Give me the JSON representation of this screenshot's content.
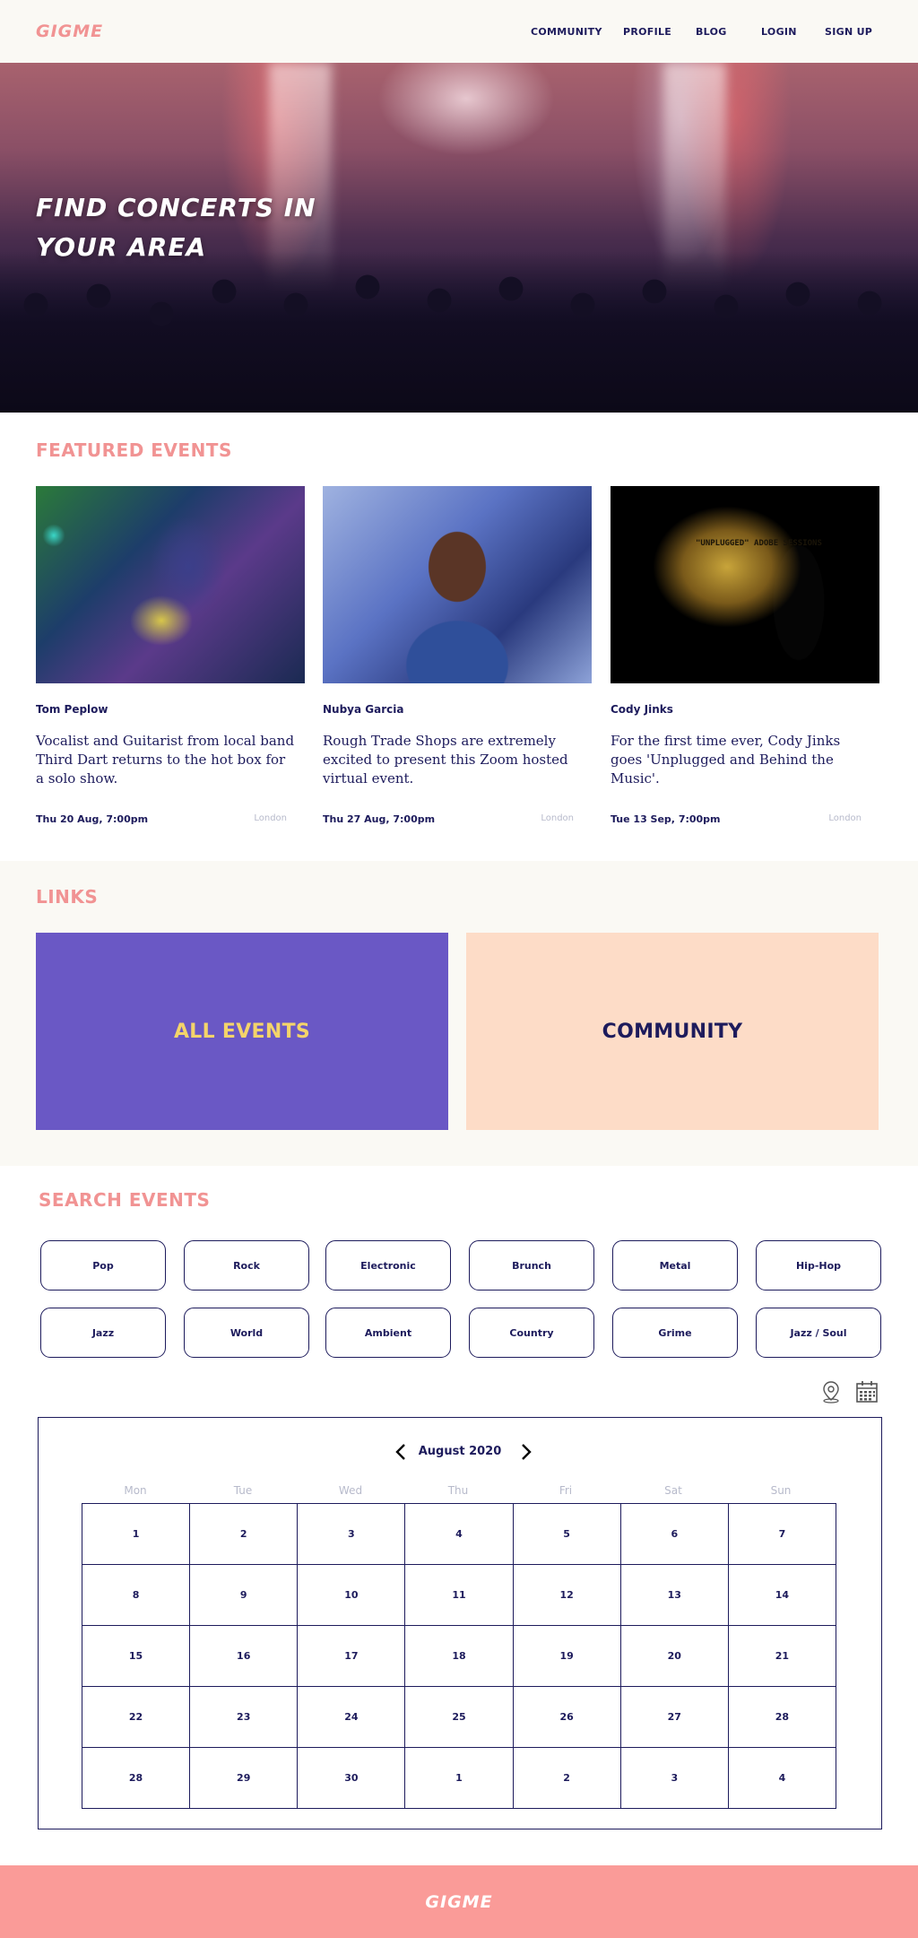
{
  "header": {
    "logo": "GIGME",
    "nav": [
      "COMMUNITY",
      "PROFILE",
      "BLOG",
      "LOGIN",
      "SIGN UP"
    ]
  },
  "hero": {
    "title": "FIND CONCERTS IN YOUR AREA"
  },
  "featured": {
    "title": "FEATURED EVENTS",
    "cards": [
      {
        "artist": "Tom Peplow",
        "description": "Vocalist and Guitarist from local band Third Dart returns to the hot box for a solo show.",
        "date": "Thu 20 Aug, 7:00pm",
        "location": "London"
      },
      {
        "artist": "Nubya Garcia",
        "description": "Rough Trade Shops are extremely excited to present this Zoom hosted virtual event.",
        "date": "Thu 27 Aug, 7:00pm",
        "location": "London"
      },
      {
        "artist": "Cody Jinks",
        "description": "For the first time ever, Cody Jinks goes 'Unplugged and Behind the Music'.",
        "date": "Tue 13 Sep, 7:00pm",
        "location": "London",
        "image_text": "\"UNPLUGGED\" ADOBE SESSIONS"
      }
    ]
  },
  "links": {
    "title": "LINKS",
    "all_events": "ALL EVENTS",
    "community": "COMMUNITY"
  },
  "search": {
    "title": "SEARCH EVENTS",
    "genres": [
      "Pop",
      "Rock",
      "Electronic",
      "Brunch",
      "Metal",
      "Hip-Hop",
      "Jazz",
      "World",
      "Ambient",
      "Country",
      "Grime",
      "Jazz / Soul"
    ],
    "icons": [
      "map-pin-icon",
      "calendar-icon"
    ],
    "calendar": {
      "month": "August 2020",
      "weekdays": [
        "Mon",
        "Tue",
        "Wed",
        "Thu",
        "Fri",
        "Sat",
        "Sun"
      ],
      "days": [
        "1",
        "2",
        "3",
        "4",
        "5",
        "6",
        "7",
        "8",
        "9",
        "10",
        "11",
        "12",
        "13",
        "14",
        "15",
        "16",
        "17",
        "18",
        "19",
        "20",
        "21",
        "22",
        "23",
        "24",
        "25",
        "26",
        "27",
        "28",
        "28",
        "29",
        "30",
        "1",
        "2",
        "3",
        "4"
      ]
    }
  },
  "footer": {
    "logo": "GIGME"
  },
  "colors": {
    "accent_pink": "#f19393",
    "navy": "#1d1b5c",
    "purple_tile": "#6a58c5",
    "peach_tile": "#fddcc7",
    "yellow_text": "#f4d46a",
    "footer_bg": "#fa9b98",
    "cream_bg": "#faf9f4"
  }
}
